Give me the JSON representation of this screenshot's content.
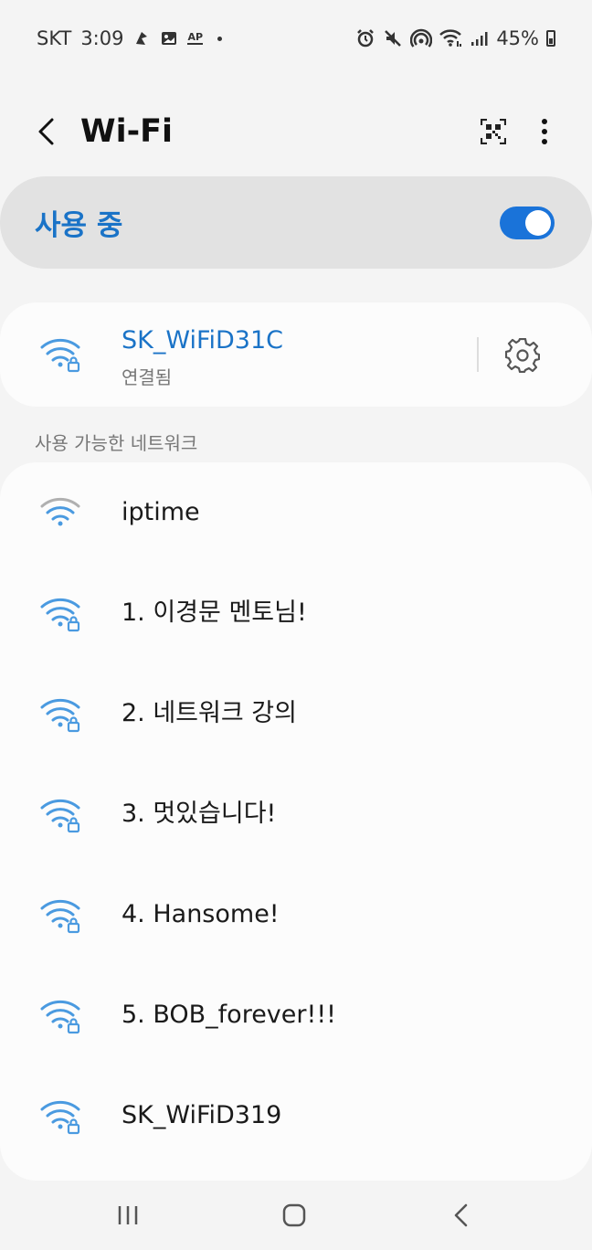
{
  "status_bar": {
    "carrier": "SKT",
    "time": "3:09",
    "battery": "45%",
    "icons": [
      "notification-icon",
      "image-icon",
      "ap-icon",
      "dot-icon",
      "alarm-icon",
      "mute-icon",
      "hotspot-icon",
      "wifi-status-icon",
      "signal-icon",
      "battery-icon"
    ],
    "ap_label": "AP"
  },
  "header": {
    "title": "Wi-Fi",
    "back_icon": "back-arrow-icon",
    "qr_icon": "qr-code-icon",
    "more_icon": "more-vertical-icon"
  },
  "master_switch": {
    "label": "사용 중",
    "on": true
  },
  "connected": {
    "name": "SK_WiFiD31C",
    "status": "연결됨",
    "icon": "wifi-lock-icon",
    "settings_icon": "gear-icon"
  },
  "available": {
    "header": "사용 가능한 네트워크",
    "networks": [
      {
        "name": "iptime",
        "secured": false,
        "weak": true
      },
      {
        "name": "1. 이경문 멘토님!",
        "secured": true
      },
      {
        "name": "2. 네트워크 강의",
        "secured": true
      },
      {
        "name": "3. 멋있습니다!",
        "secured": true
      },
      {
        "name": "4. Hansome!",
        "secured": true
      },
      {
        "name": "5. BOB_forever!!!",
        "secured": true
      },
      {
        "name": "SK_WiFiD319",
        "secured": true
      }
    ]
  },
  "nav_bar": {
    "recents_icon": "recents-icon",
    "home_icon": "home-icon",
    "back_icon": "nav-back-icon"
  },
  "colors": {
    "accent": "#1a73c7",
    "wifi_icon": "#4a9ae0",
    "wifi_weak": "#b0b0b0"
  }
}
